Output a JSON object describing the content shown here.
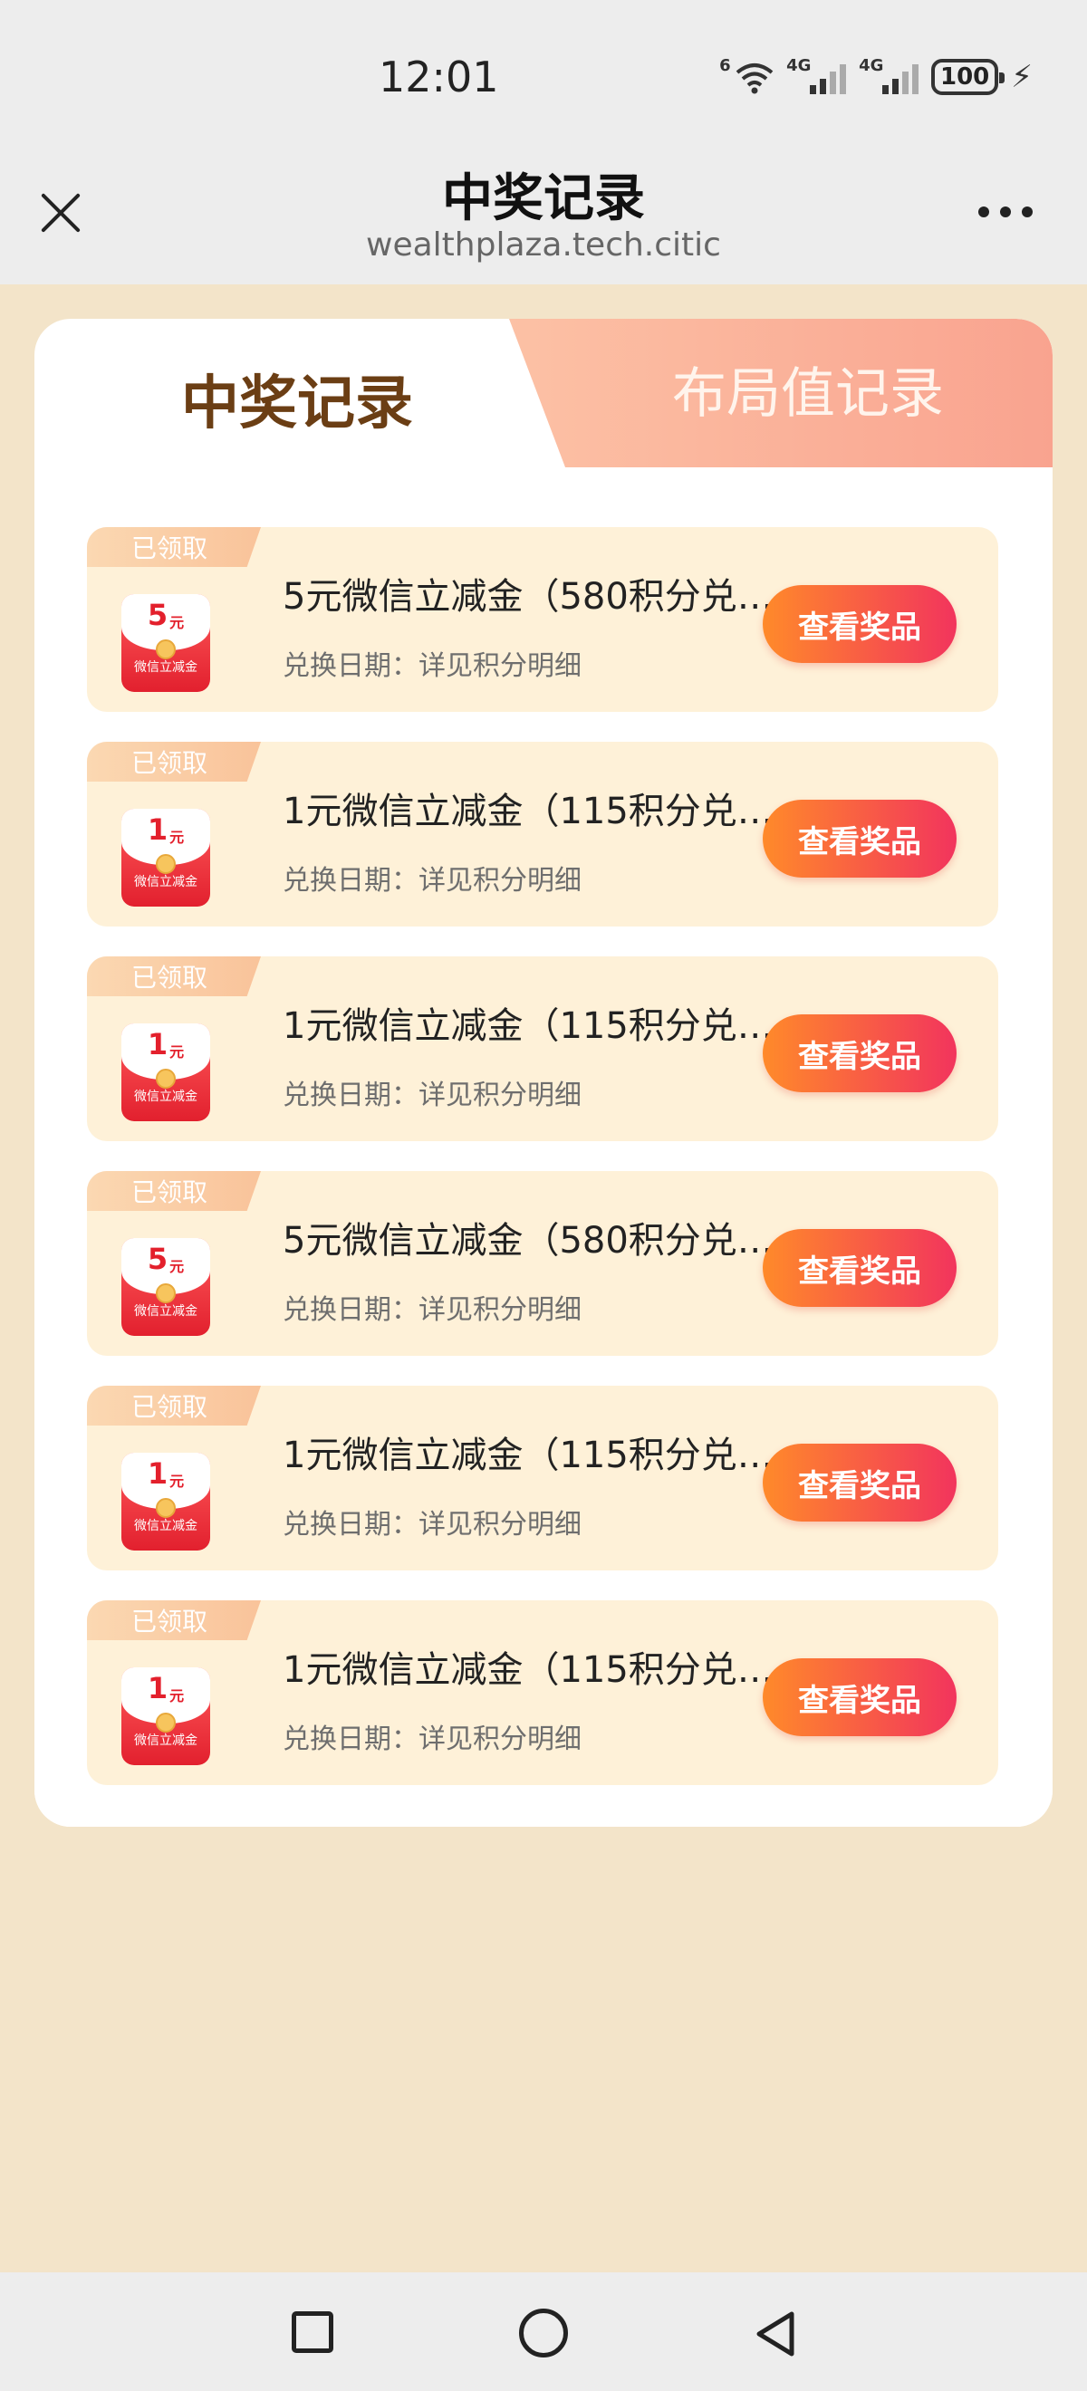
{
  "status_bar": {
    "time": "12:01",
    "wifi_tag": "6",
    "signal1_tag": "4G",
    "signal2_tag": "4G",
    "battery": "100"
  },
  "header": {
    "title": "中奖记录",
    "url": "wealthplaza.tech.citic"
  },
  "tabs": {
    "active": "中奖记录",
    "inactive": "布局值记录"
  },
  "records": [
    {
      "badge": "已领取",
      "amount": "5",
      "unit": "元",
      "coupon_label": "微信立减金",
      "title": "5元微信立减金（580积分兑…",
      "date": "兑换日期：详见积分明细",
      "button": "查看奖品"
    },
    {
      "badge": "已领取",
      "amount": "1",
      "unit": "元",
      "coupon_label": "微信立减金",
      "title": "1元微信立减金（115积分兑…",
      "date": "兑换日期：详见积分明细",
      "button": "查看奖品"
    },
    {
      "badge": "已领取",
      "amount": "1",
      "unit": "元",
      "coupon_label": "微信立减金",
      "title": "1元微信立减金（115积分兑…",
      "date": "兑换日期：详见积分明细",
      "button": "查看奖品"
    },
    {
      "badge": "已领取",
      "amount": "5",
      "unit": "元",
      "coupon_label": "微信立减金",
      "title": "5元微信立减金（580积分兑…",
      "date": "兑换日期：详见积分明细",
      "button": "查看奖品"
    },
    {
      "badge": "已领取",
      "amount": "1",
      "unit": "元",
      "coupon_label": "微信立减金",
      "title": "1元微信立减金（115积分兑…",
      "date": "兑换日期：详见积分明细",
      "button": "查看奖品"
    },
    {
      "badge": "已领取",
      "amount": "1",
      "unit": "元",
      "coupon_label": "微信立减金",
      "title": "1元微信立减金（115积分兑…",
      "date": "兑换日期：详见积分明细",
      "button": "查看奖品"
    }
  ],
  "icons": {
    "close": "close-icon",
    "more": "more-icon",
    "nav_recent": "square-icon",
    "nav_home": "circle-icon",
    "nav_back": "triangle-back-icon"
  },
  "colors": {
    "page_bg": "#f3e4c9",
    "item_bg": "#fef1d8",
    "tab_active_text": "#6b3e14",
    "button_gradient_start": "#ff8a2a",
    "button_gradient_end": "#f2345d"
  }
}
